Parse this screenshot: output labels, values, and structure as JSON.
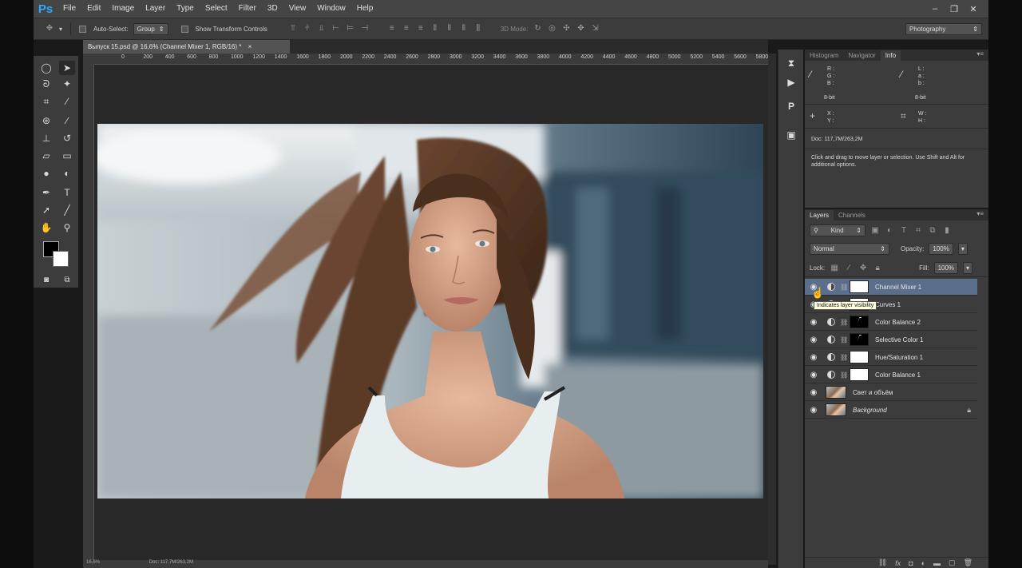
{
  "app": {
    "logo": "Ps",
    "menus": [
      "File",
      "Edit",
      "Image",
      "Layer",
      "Type",
      "Select",
      "Filter",
      "3D",
      "View",
      "Window",
      "Help"
    ],
    "window_controls": [
      "–",
      "❐",
      "✕"
    ]
  },
  "options": {
    "auto_select_label": "Auto-Select:",
    "auto_select_value": "Group",
    "transform_label": "Show Transform Controls",
    "mode3d_label": "3D Mode:",
    "workspace": "Photography"
  },
  "document": {
    "tab_title": "Выпуск 15.psd @ 16,6% (Channel Mixer 1, RGB/16) *",
    "tab_close": "×",
    "ruler_ticks": [
      "0",
      "200",
      "400",
      "600",
      "800",
      "1000",
      "1200",
      "1400",
      "1600",
      "1800",
      "2000",
      "2200",
      "2400",
      "2600",
      "2800",
      "3000",
      "3200",
      "3400",
      "3600",
      "3800",
      "4000",
      "4200",
      "4400",
      "4600",
      "4800",
      "5000",
      "5200",
      "5400",
      "5600",
      "5800",
      "60"
    ],
    "status_zoom": "16,6%",
    "status_doc": "Doc: 117,7M/263,2M"
  },
  "info_panel": {
    "tabs": [
      "Histogram",
      "Navigator",
      "Info"
    ],
    "active_tab": "Info",
    "rgb_labels": "R :\nG :\nB :",
    "lab_labels": "L :\na :\nb :",
    "bit_left": "8-bit",
    "bit_right": "8-bit",
    "xy_labels": "X :\nY :",
    "wh_labels": "W :\nH :",
    "doc": "Doc: 117,7M/263,2M",
    "hint": "Click and drag to move layer or selection.  Use Shift and Alt for additional options."
  },
  "layers_panel": {
    "tabs": [
      "Layers",
      "Channels"
    ],
    "filter_kind": "Kind",
    "blend_mode": "Normal",
    "opacity_label": "Opacity:",
    "opacity_value": "100%",
    "lock_label": "Lock:",
    "fill_label": "Fill:",
    "fill_value": "100%",
    "tooltip": "Indicates layer visibility",
    "layers": [
      {
        "name": "Channel Mixer 1",
        "type": "adjustment",
        "mask": "white",
        "selected": true
      },
      {
        "name": "Curves 1",
        "type": "adjustment",
        "mask": "white",
        "selected": false
      },
      {
        "name": "Color Balance 2",
        "type": "adjustment",
        "mask": "shape",
        "selected": false
      },
      {
        "name": "Selective Color 1",
        "type": "adjustment",
        "mask": "shape",
        "selected": false
      },
      {
        "name": "Hue/Saturation 1",
        "type": "adjustment",
        "mask": "white",
        "selected": false
      },
      {
        "name": "Color Balance 1",
        "type": "adjustment",
        "mask": "white",
        "selected": false
      },
      {
        "name": "Свет и объём",
        "type": "pixel",
        "selected": false
      },
      {
        "name": "Background",
        "type": "background",
        "selected": false
      }
    ]
  },
  "colors": {
    "selected_layer": "#5b6f8c",
    "panel_bg": "#3c3c3c",
    "ps_blue": "#31a8ff"
  }
}
